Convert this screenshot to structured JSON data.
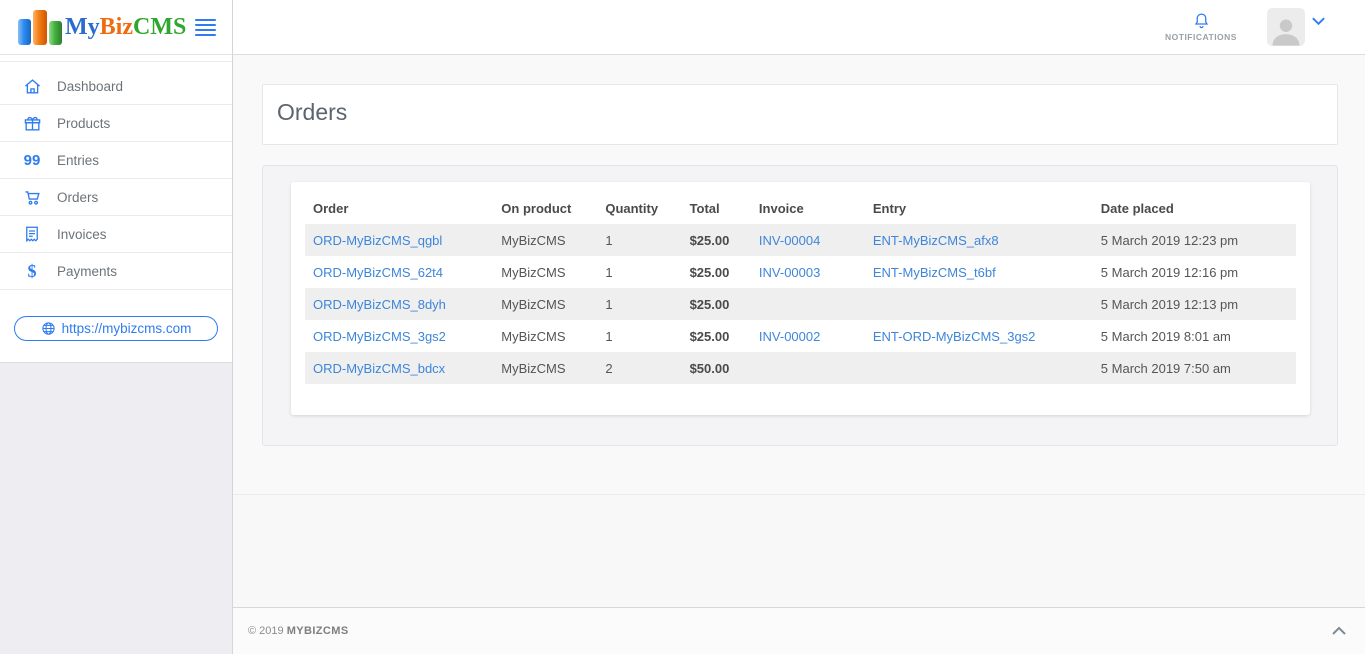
{
  "brand": {
    "segments": [
      {
        "text": "My"
      },
      {
        "text": "Biz"
      },
      {
        "text": "CMS"
      }
    ],
    "logo_icon": "bar-chart-logo",
    "colors": {
      "blue": "#2b6bd0",
      "orange": "#f06a0f",
      "green": "#2fa62d",
      "accent": "#2e7cf0",
      "link": "#3d86d9"
    }
  },
  "sidebar": {
    "items": [
      {
        "label": "Dashboard",
        "icon": "home-icon"
      },
      {
        "label": "Products",
        "icon": "gift-icon"
      },
      {
        "label": "Entries",
        "icon": "99-icon",
        "icon_text": "99"
      },
      {
        "label": "Orders",
        "icon": "cart-icon"
      },
      {
        "label": "Invoices",
        "icon": "invoice-icon"
      },
      {
        "label": "Payments",
        "icon": "dollar-icon",
        "icon_text": "$"
      }
    ],
    "site_button": {
      "label": "https://mybizcms.com",
      "icon": "globe-icon"
    }
  },
  "topbar": {
    "notifications_label": "NOTIFICATIONS",
    "bell_icon": "bell-icon",
    "avatar_icon": "person-icon",
    "menu_chevron": "chevron-down-icon"
  },
  "page": {
    "title": "Orders"
  },
  "table": {
    "headers": [
      "Order",
      "On product",
      "Quantity",
      "Total",
      "Invoice",
      "Entry",
      "Date placed"
    ],
    "rows": [
      {
        "order": "ORD-MyBizCMS_qgbl",
        "product": "MyBizCMS",
        "quantity": "1",
        "total": "$25.00",
        "invoice": "INV-00004",
        "entry": "ENT-MyBizCMS_afx8",
        "date": "5 March 2019 12:23 pm"
      },
      {
        "order": "ORD-MyBizCMS_62t4",
        "product": "MyBizCMS",
        "quantity": "1",
        "total": "$25.00",
        "invoice": "INV-00003",
        "entry": "ENT-MyBizCMS_t6bf",
        "date": "5 March 2019 12:16 pm"
      },
      {
        "order": "ORD-MyBizCMS_8dyh",
        "product": "MyBizCMS",
        "quantity": "1",
        "total": "$25.00",
        "invoice": "",
        "entry": "",
        "date": "5 March 2019 12:13 pm"
      },
      {
        "order": "ORD-MyBizCMS_3gs2",
        "product": "MyBizCMS",
        "quantity": "1",
        "total": "$25.00",
        "invoice": "INV-00002",
        "entry": "ENT-ORD-MyBizCMS_3gs2",
        "date": "5 March 2019 8:01 am"
      },
      {
        "order": "ORD-MyBizCMS_bdcx",
        "product": "MyBizCMS",
        "quantity": "2",
        "total": "$50.00",
        "invoice": "",
        "entry": "",
        "date": "5 March 2019 7:50 am"
      }
    ]
  },
  "footer": {
    "copyright": "© 2019",
    "brand": "MYBIZCMS",
    "scroll_top_icon": "chevron-up-icon"
  }
}
